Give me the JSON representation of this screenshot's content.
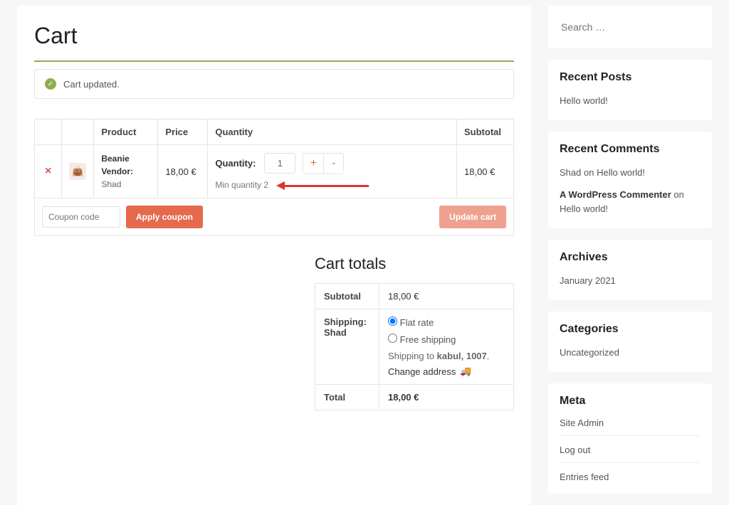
{
  "page": {
    "title": "Cart",
    "notice": "Cart updated."
  },
  "cart": {
    "headers": {
      "product": "Product",
      "price": "Price",
      "quantity": "Quantity",
      "subtotal": "Subtotal"
    },
    "item": {
      "name": "Beanie",
      "vendor_label": "Vendor:",
      "vendor": "Shad",
      "price": "18,00 €",
      "quantity_label": "Quantity:",
      "quantity_value": "1",
      "min_quantity_text": "Min quantity 2",
      "subtotal": "18,00 €"
    },
    "coupon_placeholder": "Coupon code",
    "apply_coupon": "Apply coupon",
    "update_cart": "Update cart"
  },
  "totals": {
    "heading": "Cart totals",
    "rows": {
      "subtotal_label": "Subtotal",
      "subtotal_value": "18,00 €",
      "shipping_label": "Shipping: Shad",
      "flat_rate": "Flat rate",
      "free_shipping": "Free shipping",
      "shipping_to_prefix": "Shipping to ",
      "shipping_to_dest": "kabul, 1007",
      "change_address": "Change address",
      "total_label": "Total",
      "total_value": "18,00 €"
    }
  },
  "sidebar": {
    "search_placeholder": "Search …",
    "recent_posts": {
      "title": "Recent Posts",
      "items": [
        "Hello world!"
      ]
    },
    "recent_comments": {
      "title": "Recent Comments",
      "items": [
        {
          "author": "Shad",
          "on": "on",
          "post": "Hello world!"
        },
        {
          "author": "A WordPress Commenter",
          "on": "on",
          "post": "Hello world!"
        }
      ]
    },
    "archives": {
      "title": "Archives",
      "items": [
        "January 2021"
      ]
    },
    "categories": {
      "title": "Categories",
      "items": [
        "Uncategorized"
      ]
    },
    "meta": {
      "title": "Meta",
      "items": [
        "Site Admin",
        "Log out",
        "Entries feed"
      ]
    }
  }
}
